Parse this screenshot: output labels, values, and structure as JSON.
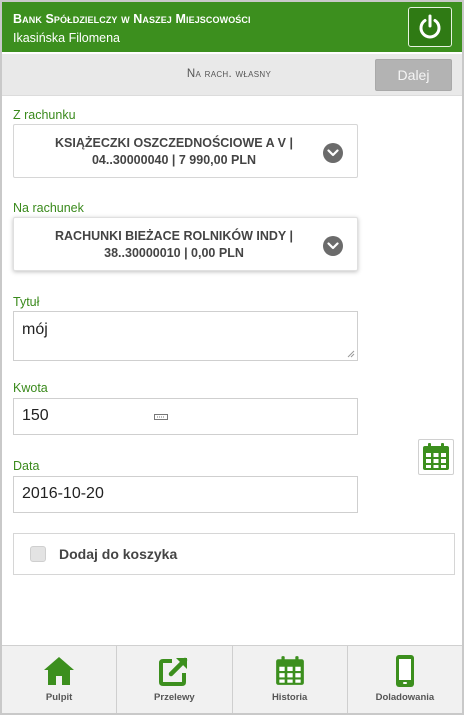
{
  "header": {
    "bank_name": "Bank Spółdzielczy w Naszej Miejscowości",
    "user_name": "Ikasińska Filomena"
  },
  "subheader": {
    "title": "Na rach. własny",
    "next_label": "Dalej"
  },
  "form": {
    "from_account": {
      "label": "Z rachunku",
      "line1": "KSIĄŻECZKI OSZCZEDNOŚCIOWE A V |",
      "line2": "04..30000040 | 7 990,00 PLN"
    },
    "to_account": {
      "label": "Na rachunek",
      "line1": "RACHUNKI BIEŻACE ROLNIKÓW INDY |",
      "line2": "38..30000010 | 0,00 PLN"
    },
    "title": {
      "label": "Tytuł",
      "value": "mój"
    },
    "amount": {
      "label": "Kwota",
      "value": "150"
    },
    "date": {
      "label": "Data",
      "value": "2016-10-20"
    },
    "basket": {
      "label": "Dodaj do koszyka",
      "checked": false
    }
  },
  "nav": {
    "items": [
      {
        "label": "Pulpit",
        "icon": "home-icon"
      },
      {
        "label": "Przelewy",
        "icon": "transfer-icon"
      },
      {
        "label": "Historia",
        "icon": "calendar-icon"
      },
      {
        "label": "Doladowania",
        "icon": "phone-icon"
      }
    ]
  },
  "colors": {
    "brand_green": "#3c8f1e",
    "label_green": "#3a8a1c",
    "disabled_button": "#b3b3b3"
  }
}
